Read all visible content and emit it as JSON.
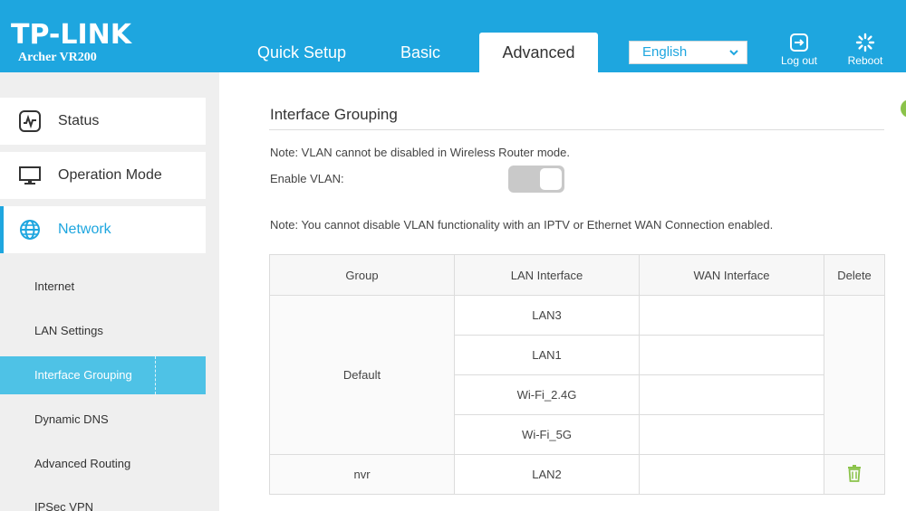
{
  "brand": {
    "logo": "TP-LINK",
    "model": "Archer VR200"
  },
  "tabs": [
    {
      "label": "Quick Setup"
    },
    {
      "label": "Basic"
    },
    {
      "label": "Advanced",
      "active": true
    }
  ],
  "language": {
    "selected": "English"
  },
  "header_buttons": {
    "logout": "Log out",
    "reboot": "Reboot"
  },
  "sidebar": {
    "main_items": [
      {
        "label": "Status",
        "icon": "status-icon"
      },
      {
        "label": "Operation Mode",
        "icon": "monitor-icon"
      },
      {
        "label": "Network",
        "icon": "globe-icon",
        "active": true
      }
    ],
    "sub_items": [
      {
        "label": "Internet"
      },
      {
        "label": "LAN Settings"
      },
      {
        "label": "Interface Grouping",
        "active": true
      },
      {
        "label": "Dynamic DNS"
      },
      {
        "label": "Advanced Routing"
      },
      {
        "label": "IPSec VPN"
      }
    ]
  },
  "main": {
    "title": "Interface Grouping",
    "note1": "Note: VLAN cannot be disabled in Wireless Router mode.",
    "vlan_label": "Enable VLAN:",
    "note2": "Note: You cannot disable VLAN functionality with an IPTV or Ethernet WAN Connection enabled.",
    "table": {
      "headers": [
        "Group",
        "LAN Interface",
        "WAN Interface",
        "Delete"
      ],
      "groups": [
        {
          "name": "Default",
          "lan": [
            "LAN3",
            "LAN1",
            "Wi-Fi_2.4G",
            "Wi-Fi_5G"
          ],
          "wan": ""
        },
        {
          "name": "nvr",
          "lan": [
            "LAN2"
          ],
          "wan": ""
        }
      ]
    }
  },
  "colors": {
    "brand_blue": "#1ea6df",
    "active_sub": "#4ec2e6",
    "trash_green": "#8bc34a"
  }
}
